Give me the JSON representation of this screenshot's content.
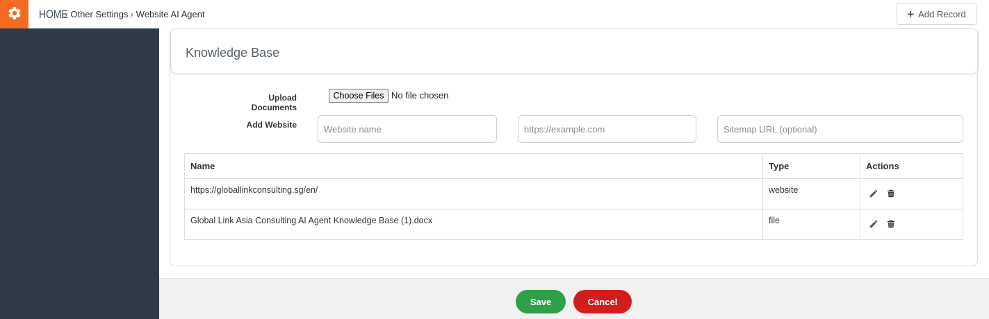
{
  "breadcrumb": {
    "home": "HOME",
    "items": [
      "Other Settings",
      "Website AI Agent"
    ]
  },
  "toolbar": {
    "add_record_label": "Add Record"
  },
  "card": {
    "title": "Knowledge Base"
  },
  "form": {
    "upload_label": "Upload Documents",
    "choose_files_label": "Choose Files",
    "no_file_text": "No file chosen",
    "add_website_label": "Add Website",
    "website_name_placeholder": "Website name",
    "website_url_placeholder": "https://example.com",
    "sitemap_placeholder": "Sitemap URL (optional)"
  },
  "table": {
    "headers": [
      "Name",
      "Type",
      "Actions"
    ],
    "rows": [
      {
        "name": "https://globallinkconsulting.sg/en/",
        "type": "website"
      },
      {
        "name": "Global Link Asia Consulting AI Agent Knowledge Base (1).docx",
        "type": "file"
      }
    ]
  },
  "footer": {
    "save_label": "Save",
    "cancel_label": "Cancel"
  },
  "colors": {
    "accent_orange": "#f36a22",
    "sidebar": "#2e3b47",
    "save_green": "#2ea049",
    "cancel_red": "#d21d1d"
  },
  "icons": [
    "gear-icon",
    "chevron-right-icon",
    "plus-icon",
    "pencil-icon",
    "trash-icon"
  ]
}
